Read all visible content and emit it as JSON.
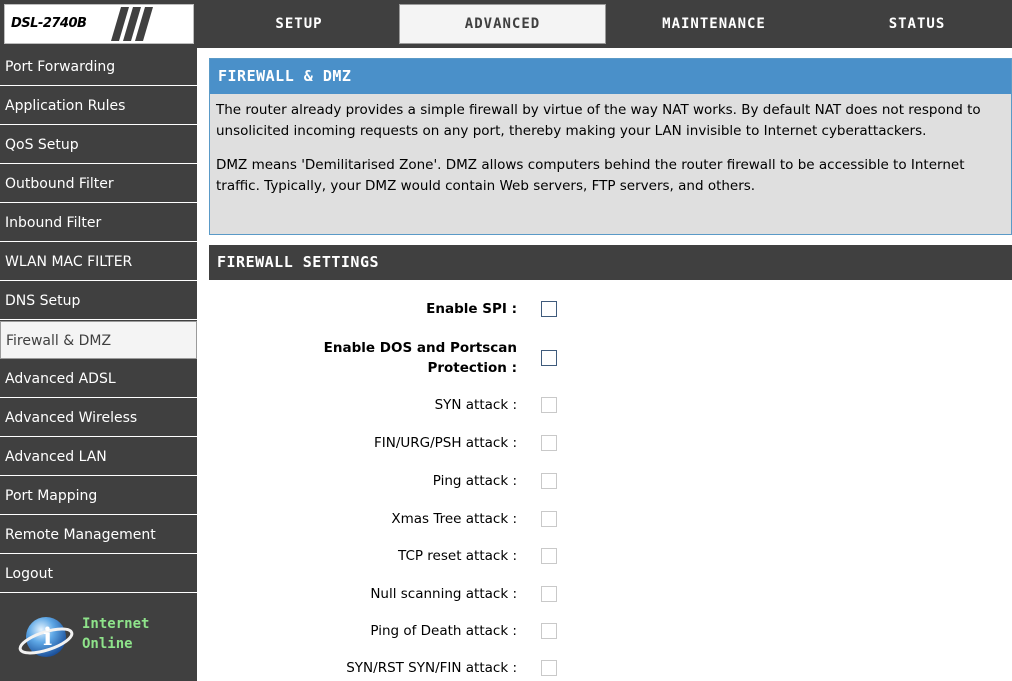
{
  "brand": {
    "model": "DSL-2740B"
  },
  "tabs": [
    {
      "label": "SETUP",
      "active": false
    },
    {
      "label": "ADVANCED",
      "active": true
    },
    {
      "label": "MAINTENANCE",
      "active": false
    },
    {
      "label": "STATUS",
      "active": false
    }
  ],
  "sidebar": {
    "items": [
      {
        "label": "Port Forwarding"
      },
      {
        "label": "Application Rules"
      },
      {
        "label": "QoS Setup"
      },
      {
        "label": "Outbound Filter"
      },
      {
        "label": "Inbound Filter"
      },
      {
        "label": "WLAN MAC FILTER"
      },
      {
        "label": "DNS Setup"
      },
      {
        "label": "Firewall & DMZ",
        "active": true
      },
      {
        "label": "Advanced ADSL"
      },
      {
        "label": "Advanced Wireless"
      },
      {
        "label": "Advanced LAN"
      },
      {
        "label": "Port Mapping"
      },
      {
        "label": "Remote Management"
      },
      {
        "label": "Logout"
      }
    ],
    "status": {
      "line1": "Internet",
      "line2": "Online",
      "icon": "globe-info-icon"
    }
  },
  "intro": {
    "title": "FIREWALL & DMZ",
    "paragraph1": "The router already provides a simple firewall by virtue of the way NAT works. By default NAT does not respond to unsolicited incoming requests on any port, thereby making your LAN invisible to Internet cyberattackers.",
    "paragraph2": "DMZ means 'Demilitarised Zone'. DMZ allows computers behind the router firewall to be accessible to Internet traffic. Typically, your DMZ would contain Web servers, FTP servers, and others."
  },
  "firewall": {
    "title": "FIREWALL SETTINGS",
    "enable_spi": {
      "label": "Enable SPI :",
      "checked": false,
      "enabled": true
    },
    "enable_dos": {
      "label_line1": "Enable DOS and Portscan",
      "label_line2": "Protection :",
      "checked": false,
      "enabled": true
    },
    "attacks": [
      {
        "label": "SYN attack :",
        "checked": false,
        "enabled": false
      },
      {
        "label": "FIN/URG/PSH attack :",
        "checked": false,
        "enabled": false
      },
      {
        "label": "Ping attack :",
        "checked": false,
        "enabled": false
      },
      {
        "label": "Xmas Tree attack :",
        "checked": false,
        "enabled": false
      },
      {
        "label": "TCP reset attack :",
        "checked": false,
        "enabled": false
      },
      {
        "label": "Null scanning attack :",
        "checked": false,
        "enabled": false
      },
      {
        "label": "Ping of Death attack :",
        "checked": false,
        "enabled": false
      },
      {
        "label": "SYN/RST SYN/FIN attack :",
        "checked": false,
        "enabled": false
      }
    ]
  },
  "colors": {
    "nav_dark": "#404040",
    "intro_header_blue": "#4a90c9",
    "intro_bg": "#dfdfdf",
    "status_green": "#8ee38a"
  }
}
